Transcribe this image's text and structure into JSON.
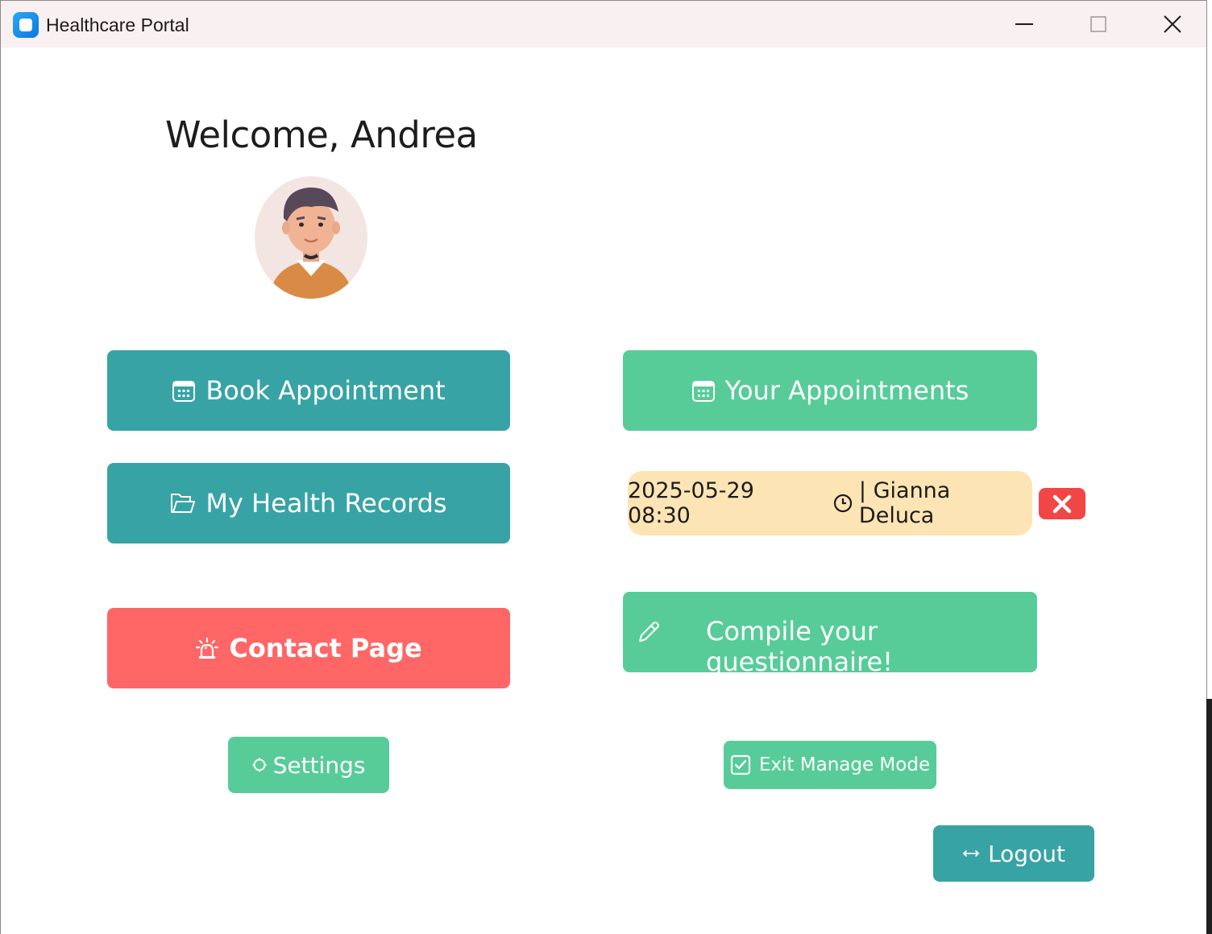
{
  "window": {
    "title": "Healthcare Portal",
    "controls": [
      "minimize-icon",
      "maximize-icon",
      "close-icon"
    ]
  },
  "header": {
    "welcome_text": "Welcome, Andrea",
    "avatar_icon": "user-avatar-icon"
  },
  "actions": {
    "book_appointment": {
      "label": "Book Appointment",
      "icon": "calendar-icon"
    },
    "your_appointments": {
      "label": "Your Appointments",
      "icon": "calendar-icon"
    },
    "health_records": {
      "label": "My Health Records",
      "icon": "folder-icon"
    },
    "contact_page": {
      "label": "Contact Page",
      "icon": "alarm-light-icon"
    },
    "questionnaire": {
      "label": "Compile your questionnaire!",
      "icon": "pencil-icon"
    },
    "settings": {
      "label": "Settings",
      "icon": "gear-icon"
    },
    "exit_manage": {
      "label": "Exit Manage Mode",
      "icon": "checkbox-icon"
    },
    "logout": {
      "label": "Logout",
      "icon": "arrow-exchange-icon"
    }
  },
  "appointment": {
    "datetime": "2025-05-29 08:30",
    "separator_doctor": "| Gianna Deluca",
    "icon": "clock-icon",
    "cancel_icon": "close-icon"
  },
  "colors": {
    "teal": "#38a3a5",
    "green": "#57cc99",
    "red": "#ff6666",
    "pill": "#fde4b4",
    "cancel": "#f24646"
  }
}
